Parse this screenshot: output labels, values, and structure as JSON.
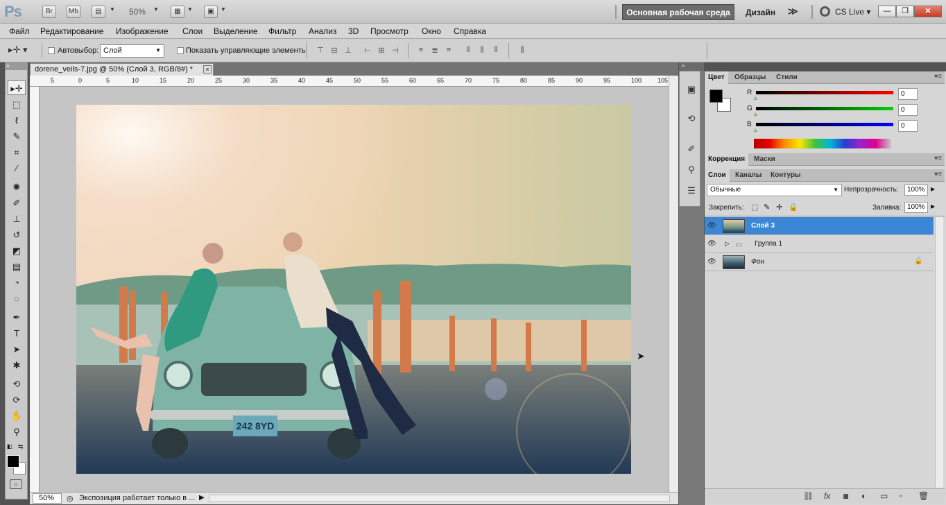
{
  "titlebar": {
    "logo": "Ps",
    "br": "Br",
    "mb": "Mb",
    "zoom": "50%",
    "workspace_basic": "Основная рабочая среда",
    "workspace_design": "Дизайн",
    "more": "≫",
    "cs_live": "CS Live",
    "min": "—",
    "max": "❐",
    "close": "✕"
  },
  "menu": [
    "Файл",
    "Редактирование",
    "Изображение",
    "Слои",
    "Выделение",
    "Фильтр",
    "Анализ",
    "3D",
    "Просмотр",
    "Окно",
    "Справка"
  ],
  "options": {
    "autoselect_label": "Автовыбор:",
    "autoselect_value": "Слой",
    "show_controls_label": "Показать управляющие элементы"
  },
  "document": {
    "tab_title": "dorene_veils-7.jpg @ 50% (Слой 3, RGB/8#) *",
    "close": "×",
    "ruler_ticks": [
      "5",
      "0",
      "5",
      "10",
      "15",
      "20",
      "25",
      "30",
      "35",
      "40",
      "45",
      "50",
      "55",
      "60",
      "65",
      "70",
      "75",
      "80",
      "85",
      "90",
      "95",
      "100",
      "105"
    ],
    "plate": "242 8YD"
  },
  "status": {
    "zoom": "50%",
    "text": "Экспозиция работает только в ..."
  },
  "color_panel": {
    "tabs": [
      "Цвет",
      "Образцы",
      "Стили"
    ],
    "r_label": "R",
    "g_label": "G",
    "b_label": "B",
    "r": "0",
    "g": "0",
    "b": "0",
    "fg_color": "#000000",
    "bg_color": "#ffffff"
  },
  "adjust_panel": {
    "tabs": [
      "Коррекция",
      "Маски"
    ]
  },
  "layers_panel": {
    "tabs": [
      "Слои",
      "Каналы",
      "Контуры"
    ],
    "blend_mode": "Обычные",
    "opacity_label": "Непрозрачность:",
    "opacity": "100%",
    "lock_label": "Закрепить:",
    "fill_label": "Заливка:",
    "fill": "100%",
    "layers": [
      {
        "name": "Слой 3",
        "selected": true
      },
      {
        "name": "Группа 1",
        "selected": false
      },
      {
        "name": "Фон",
        "selected": false
      }
    ]
  },
  "colors": {
    "accent": "#3c86d6",
    "workspace_active": "#6b6b6b"
  }
}
